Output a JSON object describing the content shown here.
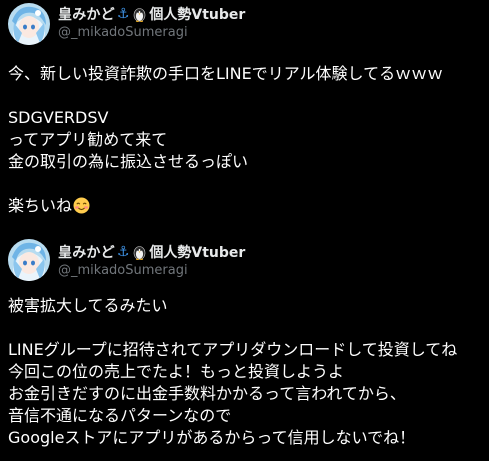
{
  "tweets": [
    {
      "author": {
        "name": "皇みかど",
        "name_suffix": "個人勢Vtuber",
        "handle": "@_mikadoSumeragi",
        "anchor_glyph": "⚓",
        "icons": [
          "avatar-icon",
          "anchor-icon",
          "penguin-icon"
        ]
      },
      "lines": [
        "今、新しい投資詐欺の手口をLINEでリアル体験してるｗｗｗ",
        "",
        "SDGVERDSV",
        "ってアプリ勧めて来て",
        "金の取引の為に振込させるっぽい",
        "",
        "楽ちいね"
      ],
      "trailing_emoji": "smiling-face-icon"
    },
    {
      "author": {
        "name": "皇みかど",
        "name_suffix": "個人勢Vtuber",
        "handle": "@_mikadoSumeragi",
        "anchor_glyph": "⚓",
        "icons": [
          "avatar-icon",
          "anchor-icon",
          "penguin-icon"
        ]
      },
      "lines": [
        "被害拡大してるみたい",
        "",
        "LINEグループに招待されてアプリダウンロードして投資してね",
        "今回この位の売上でたよ！もっと投資しようよ",
        "お金引きだすのに出金手数料かかるって言われてから、",
        "音信不通になるパターンなので",
        "Googleストアにアプリがあるからって信用しないでね！"
      ]
    }
  ],
  "colors": {
    "background": "#000000",
    "text": "#ffffff",
    "name": "#e7e9ea",
    "handle": "#71767b",
    "anchor": "#3d8fe0"
  }
}
